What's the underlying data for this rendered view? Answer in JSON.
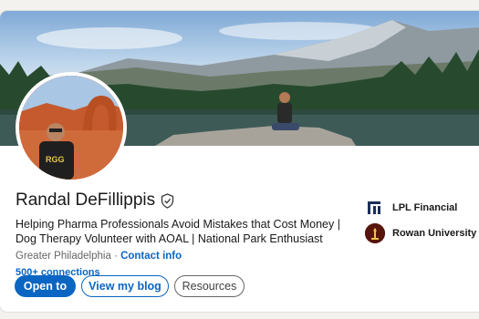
{
  "profile": {
    "name": "Randal DeFillippis",
    "headline": "Helping Pharma Professionals Avoid Mistakes that Cost Money | Dog Therapy Volunteer with AOAL | National Park Enthusiast",
    "location": "Greater Philadelphia",
    "separator": " · ",
    "contact_label": "Contact info",
    "connections": "500+ connections",
    "verified_icon": "shield-check-icon"
  },
  "actions": {
    "open_to": "Open to",
    "view_blog": "View my blog",
    "resources": "Resources"
  },
  "organizations": [
    {
      "name": "LPL Financial",
      "icon": "lpl-logo-icon"
    },
    {
      "name": "Rowan University",
      "icon": "rowan-logo-icon"
    }
  ],
  "colors": {
    "accent": "#0a66c2",
    "text": "#191919",
    "muted": "#666666"
  }
}
